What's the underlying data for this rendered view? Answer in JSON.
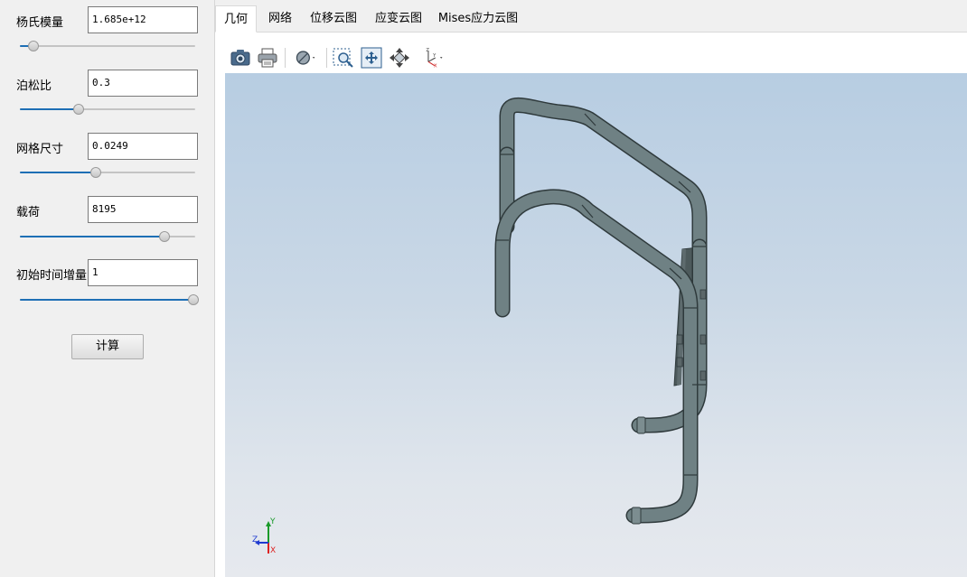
{
  "params": [
    {
      "label": "杨氏模量",
      "value": "1.685e+12",
      "slider_fraction": 0.07
    },
    {
      "label": "泊松比",
      "value": "0.3",
      "slider_fraction": 0.33
    },
    {
      "label": "网格尺寸",
      "value": "0.0249",
      "slider_fraction": 0.43
    },
    {
      "label": "载荷",
      "value": "8195",
      "slider_fraction": 0.83
    },
    {
      "label": "初始时间增量",
      "value": "1",
      "slider_fraction": 1.0
    }
  ],
  "calc_button": "计算",
  "tabs": [
    "几何",
    "网络",
    "位移云图",
    "应变云图",
    "Mises应力云图"
  ],
  "active_tab": "几何",
  "toolbar_icons": [
    "camera-icon",
    "printer-icon",
    "display-mode-icon",
    "zoom-box-icon",
    "fit-all-icon",
    "view-orientation-icon",
    "axes-view-icon"
  ],
  "axis_triad": {
    "x": "X",
    "y": "Y",
    "z": "Z"
  },
  "colors": {
    "slider_fill": "#1e6fb5",
    "model_fill": "#6f8184",
    "model_edge": "#2f3a3c"
  }
}
